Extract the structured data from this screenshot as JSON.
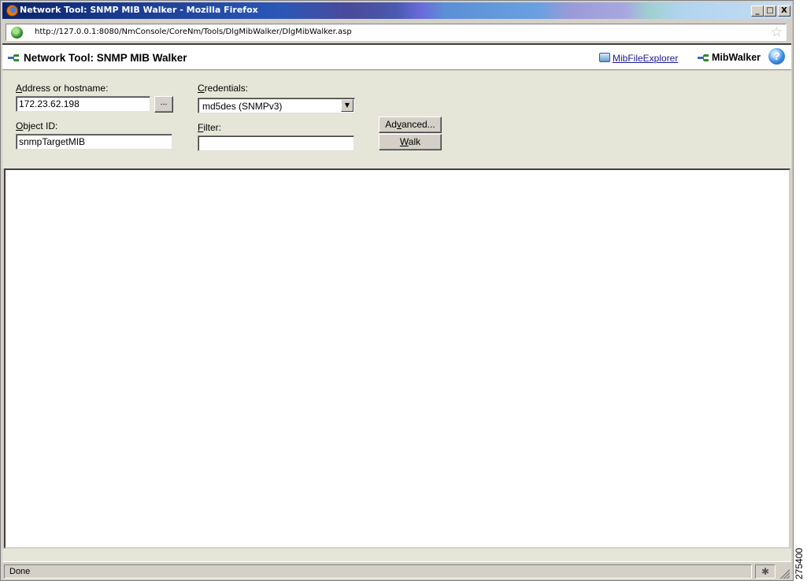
{
  "window": {
    "title": "Network Tool: SNMP MIB Walker - Mozilla Firefox",
    "minimize": "_",
    "maximize": "□",
    "close": "X"
  },
  "browser": {
    "url": "http://127.0.0.1:8080/NmConsole/CoreNm/Tools/DlgMibWalker/DlgMibWalker.asp",
    "status": "Done"
  },
  "header": {
    "title": "Network Tool: SNMP MIB Walker",
    "mib_file_explorer": "MibFileExplorer",
    "mib_walker": "MibWalker",
    "help": "?"
  },
  "form": {
    "address_label_hotkey": "A",
    "address_label_rest": "ddress or hostname:",
    "address_value": "172.23.62.198",
    "browse_button": "...",
    "credentials_label_hotkey": "C",
    "credentials_label_rest": "redentials:",
    "credentials_value": "md5des (SNMPv3)",
    "object_id_label_hotkey": "O",
    "object_id_label_rest": "bject ID:",
    "object_id_value": "snmpTargetMIB",
    "filter_label_hotkey": "F",
    "filter_label_rest": "ilter:",
    "filter_value": "",
    "advanced_prefix": "Ad",
    "advanced_hotkey": "v",
    "advanced_rest": "anced...",
    "walk_hotkey": "W",
    "walk_rest": "alk"
  },
  "figure_id": "275400",
  "icons": {
    "firefox": "firefox-icon",
    "site": "site-identity-icon",
    "bookmark": "star-icon",
    "network": "network-tool-icon",
    "mib_file": "mib-file-explorer-icon",
    "help": "help-icon",
    "status": "status-icon"
  }
}
